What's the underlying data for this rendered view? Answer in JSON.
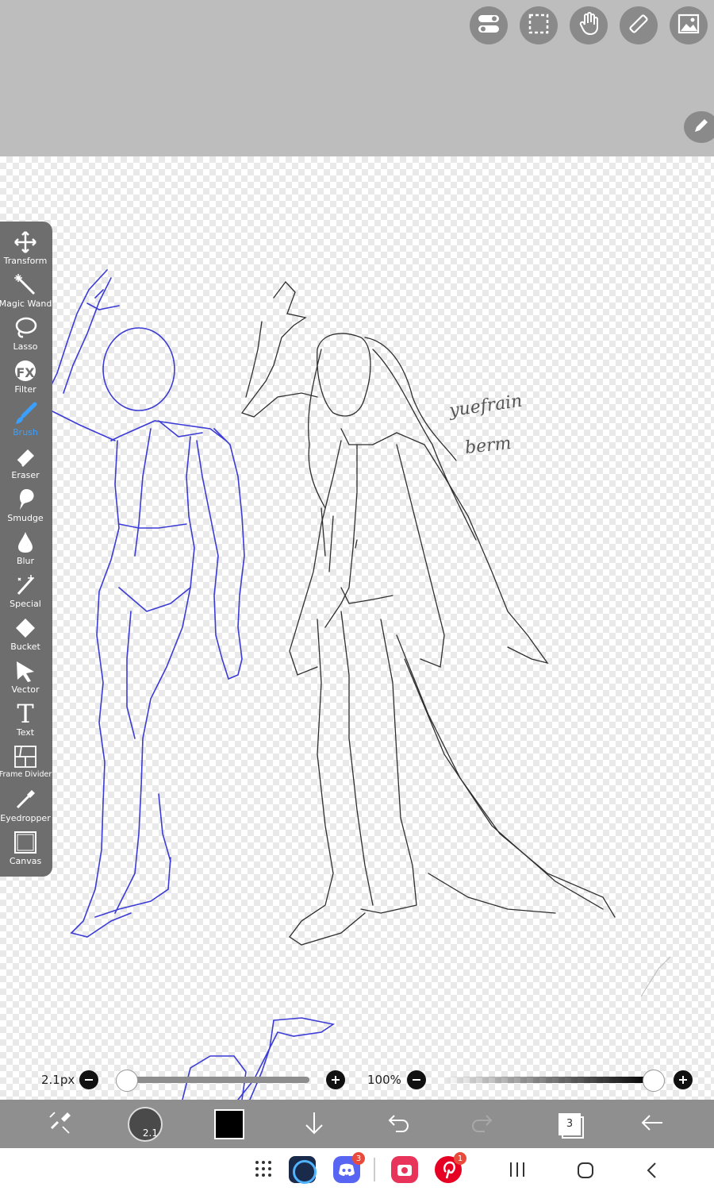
{
  "app": {
    "name": "ibisPaint"
  },
  "top_toolbar": {
    "buttons": [
      {
        "name": "layers-toggle",
        "icon": "toggle-icon"
      },
      {
        "name": "selection",
        "icon": "dashed-rect-icon"
      },
      {
        "name": "hand-tool",
        "icon": "hand-icon"
      },
      {
        "name": "ruler",
        "icon": "ruler-icon"
      },
      {
        "name": "reference-image",
        "icon": "image-icon"
      }
    ],
    "pen_button_icon": "pencil-icon"
  },
  "tools": [
    {
      "label": "Transform",
      "icon": "transform-icon"
    },
    {
      "label": "Magic Wand",
      "icon": "magic-wand-icon"
    },
    {
      "label": "Lasso",
      "icon": "lasso-icon"
    },
    {
      "label": "Filter",
      "icon": "fx-icon",
      "glyph": "FX"
    },
    {
      "label": "Brush",
      "icon": "brush-icon",
      "active": true
    },
    {
      "label": "Eraser",
      "icon": "eraser-icon"
    },
    {
      "label": "Smudge",
      "icon": "smudge-icon"
    },
    {
      "label": "Blur",
      "icon": "drop-icon"
    },
    {
      "label": "Special",
      "icon": "special-icon"
    },
    {
      "label": "Bucket",
      "icon": "bucket-icon"
    },
    {
      "label": "Vector",
      "icon": "vector-icon"
    },
    {
      "label": "Text",
      "icon": "text-icon",
      "glyph": "T"
    },
    {
      "label": "Frame Divider",
      "icon": "frame-divider-icon"
    },
    {
      "label": "Eyedropper",
      "icon": "eyedropper-icon"
    },
    {
      "label": "Canvas",
      "icon": "canvas-icon"
    }
  ],
  "canvas": {
    "annotations": [
      "yuefrain",
      "berm"
    ]
  },
  "brush_size": {
    "value_text": "2.1px",
    "fraction": 0.0
  },
  "opacity": {
    "value_text": "100%",
    "fraction": 1.0
  },
  "bottom_toolbar": {
    "brush_badge": "2.1",
    "color": "#000000",
    "layer_count": "3"
  },
  "system_nav": {
    "apps": [
      {
        "name": "ibispaint",
        "badge": ""
      },
      {
        "name": "discord",
        "badge": "3"
      },
      {
        "name": "camera",
        "badge": ""
      },
      {
        "name": "pinterest",
        "badge": "1"
      }
    ]
  },
  "colors": {
    "accent": "#3aa0ff",
    "sketch_blue": "#3b3bd6",
    "sketch_gray": "#333333"
  }
}
